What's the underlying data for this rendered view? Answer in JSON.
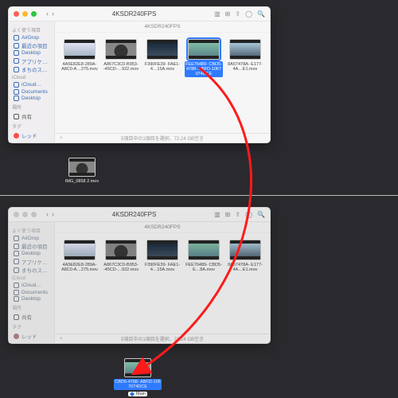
{
  "window_title": "4KSDR240FPS",
  "group_label": "4KSDR240FPS",
  "sidebar": {
    "favorites_head": "よく使う項目",
    "items": [
      "AirDrop",
      "最近の項目",
      "Desktop",
      "アプリケ…",
      "まちのス…"
    ],
    "icloud_head": "iCloud",
    "icloud_items": [
      "iCloud…",
      "Documents",
      "Desktop"
    ],
    "locations_head": "場所",
    "locations_items": [
      "共有"
    ],
    "tags_head": "タグ",
    "tag_item": "レッド"
  },
  "files": [
    {
      "name": "4A5E82E8-289A-\nA8C0-A…275.mov",
      "thumb": "t1"
    },
    {
      "name": "A867C3C0-B953-\n-45CD-…922.mov",
      "thumb": "t2"
    },
    {
      "name": "F390FE39-\nFAE1-4…15A.mov",
      "thumb": "t3"
    },
    {
      "name": "FEE76489-\nCBD5-4788-\nABFD-1067074DCE",
      "thumb": "t4",
      "selected_top": true,
      "name_bottom": "FEE76489-\nCBD5-E…8A.mov"
    },
    {
      "name": "8A57478A-\nE177-4A…E1.mov",
      "thumb": "t5"
    }
  ],
  "status_text": "5項目中の1項目を選択、72.24 GB空き",
  "status_close": "×",
  "desktop_top": {
    "name": "IMG_0858 2.mov"
  },
  "desktop_bottom": {
    "name": "CBD5-4788-\nABFD-1067074DCE",
    "tag_label": "Main"
  }
}
